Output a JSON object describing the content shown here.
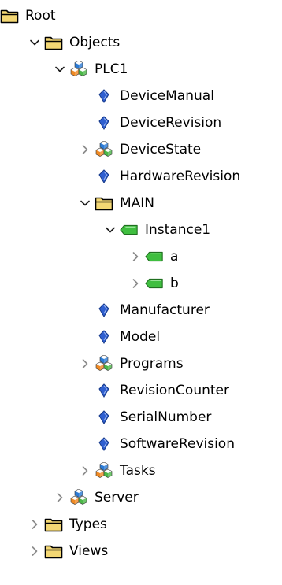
{
  "tree": [
    {
      "label": "Root",
      "depth": 0,
      "state": "none",
      "icon": "folder-icon"
    },
    {
      "label": "Objects",
      "depth": 1,
      "state": "expanded",
      "icon": "folder-icon"
    },
    {
      "label": "PLC1",
      "depth": 2,
      "state": "expanded",
      "icon": "object-cubes-icon"
    },
    {
      "label": "DeviceManual",
      "depth": 3,
      "state": "none",
      "icon": "variable-tag-icon"
    },
    {
      "label": "DeviceRevision",
      "depth": 3,
      "state": "none",
      "icon": "variable-tag-icon"
    },
    {
      "label": "DeviceState",
      "depth": 3,
      "state": "collapsed",
      "icon": "object-cubes-icon"
    },
    {
      "label": "HardwareRevision",
      "depth": 3,
      "state": "none",
      "icon": "variable-tag-icon"
    },
    {
      "label": "MAIN",
      "depth": 3,
      "state": "expanded",
      "icon": "folder-icon"
    },
    {
      "label": "Instance1",
      "depth": 4,
      "state": "expanded",
      "icon": "green-tag-icon"
    },
    {
      "label": "a",
      "depth": 5,
      "state": "collapsed",
      "icon": "green-tag-icon"
    },
    {
      "label": "b",
      "depth": 5,
      "state": "collapsed",
      "icon": "green-tag-icon"
    },
    {
      "label": "Manufacturer",
      "depth": 3,
      "state": "none",
      "icon": "variable-tag-icon"
    },
    {
      "label": "Model",
      "depth": 3,
      "state": "none",
      "icon": "variable-tag-icon"
    },
    {
      "label": "Programs",
      "depth": 3,
      "state": "collapsed",
      "icon": "object-cubes-icon"
    },
    {
      "label": "RevisionCounter",
      "depth": 3,
      "state": "none",
      "icon": "variable-tag-icon"
    },
    {
      "label": "SerialNumber",
      "depth": 3,
      "state": "none",
      "icon": "variable-tag-icon"
    },
    {
      "label": "SoftwareRevision",
      "depth": 3,
      "state": "none",
      "icon": "variable-tag-icon"
    },
    {
      "label": "Tasks",
      "depth": 3,
      "state": "collapsed",
      "icon": "object-cubes-icon"
    },
    {
      "label": "Server",
      "depth": 2,
      "state": "collapsed",
      "icon": "object-cubes-icon"
    },
    {
      "label": "Types",
      "depth": 1,
      "state": "collapsed",
      "icon": "folder-icon"
    },
    {
      "label": "Views",
      "depth": 1,
      "state": "collapsed",
      "icon": "folder-icon"
    }
  ],
  "colors": {
    "chevron_expanded": "#1a1a1a",
    "chevron_collapsed": "#8a8a8a",
    "folder_fill": "#f3d774",
    "folder_outline": "#000000",
    "tag_blue": "#2f5fd0",
    "tag_green": "#3fbe3f",
    "cube_blue": "#2b7bd6",
    "cube_green": "#4cb848",
    "cube_orange": "#f08a24"
  }
}
